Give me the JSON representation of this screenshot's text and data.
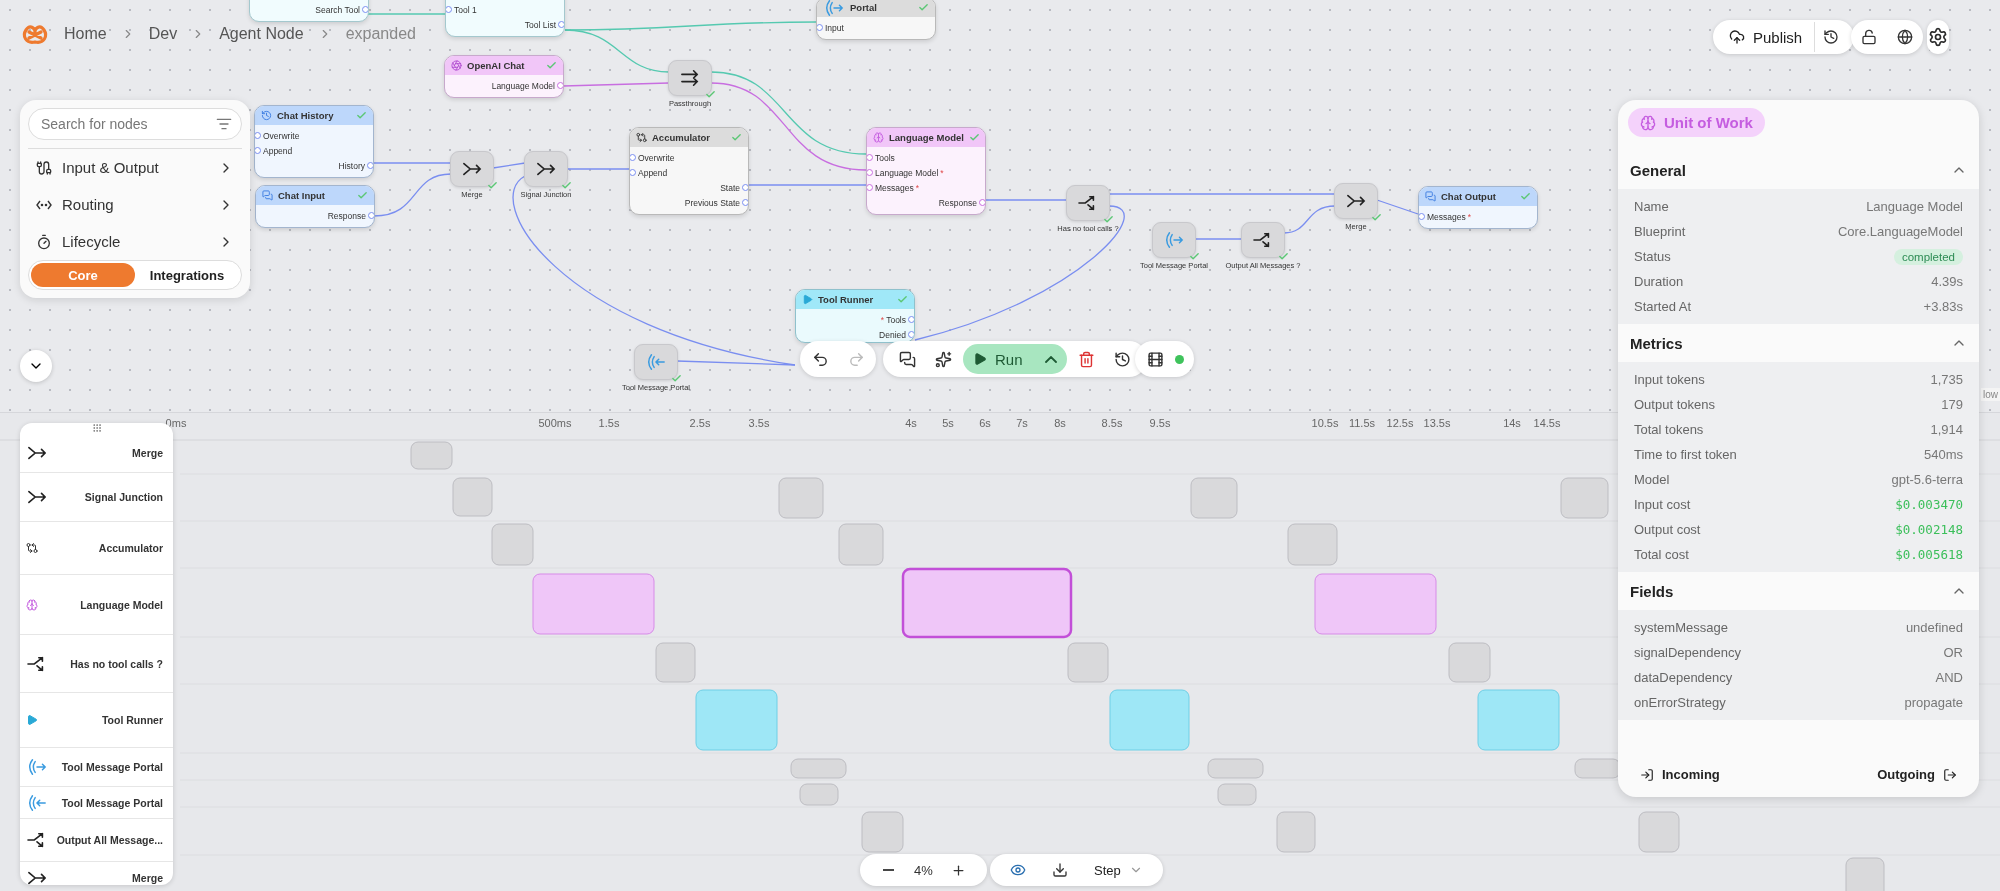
{
  "breadcrumbs": [
    "Home",
    "Dev",
    "Agent Node",
    "expanded"
  ],
  "top_actions": {
    "publish": "Publish"
  },
  "node_search": {
    "placeholder": "Search for nodes",
    "categories": [
      {
        "label": "Input & Output",
        "kind": "io"
      },
      {
        "label": "Routing",
        "kind": "routing"
      },
      {
        "label": "Lifecycle",
        "kind": "lifecycle"
      }
    ],
    "tabs": [
      {
        "label": "Core",
        "selected": true
      },
      {
        "label": "Integrations",
        "selected": false
      }
    ]
  },
  "nodes": [
    {
      "kind": "tool",
      "ports": [
        {
          "label": "Search Tool",
          "output": true
        }
      ]
    },
    {
      "kind": "tool",
      "ports": [
        {
          "label": "Tool 1",
          "output": false
        },
        {
          "label": "Tool List",
          "output": true
        }
      ]
    },
    {
      "kind": "portal",
      "title": "Portal",
      "color": "#dcdcdc",
      "completed": true,
      "ports": [
        {
          "label": "Input",
          "output": false
        }
      ]
    },
    {
      "kind": "llm-provider",
      "title": "OpenAI Chat",
      "color": "#f1c6f8",
      "completed": true,
      "ports": [
        {
          "label": "Language Model",
          "output": true
        }
      ]
    },
    {
      "kind": "passthrough",
      "title": "Passthrough",
      "completed": true
    },
    {
      "kind": "history",
      "title": "Chat History",
      "color": "#bdd7fb",
      "completed": true,
      "ports": [
        {
          "label": "Overwrite",
          "output": false
        },
        {
          "label": "Append",
          "output": false
        },
        {
          "label": "History",
          "output": true
        }
      ]
    },
    {
      "kind": "chat",
      "title": "Chat Input",
      "color": "#bdd7fb",
      "completed": true,
      "ports": [
        {
          "label": "Response",
          "output": true
        }
      ]
    },
    {
      "kind": "merge",
      "title": "Merge",
      "completed": true
    },
    {
      "kind": "merge",
      "title": "Signal Junction",
      "completed": true
    },
    {
      "kind": "accumulator",
      "title": "Accumulator",
      "color": "#dcdcdc",
      "completed": true,
      "ports": [
        {
          "label": "Overwrite",
          "output": false
        },
        {
          "label": "Append",
          "output": false
        },
        {
          "label": "State",
          "output": true
        },
        {
          "label": "Previous State",
          "output": true
        }
      ]
    },
    {
      "kind": "language-model",
      "title": "Language Model",
      "color": "#f1c6f8",
      "completed": true,
      "ports": [
        {
          "label": "Tools",
          "output": false
        },
        {
          "label": "Language Model",
          "output": false,
          "required_mark": "*"
        },
        {
          "label": "Messages",
          "output": false,
          "required_mark": "*"
        },
        {
          "label": "Response",
          "output": true
        }
      ]
    },
    {
      "kind": "condition",
      "title": "Has no tool calls ?",
      "completed": true
    },
    {
      "kind": "portal-out",
      "title": "Tool Message Portal",
      "completed": true
    },
    {
      "kind": "condition",
      "title": "Output All Messages ?",
      "completed": true
    },
    {
      "kind": "merge",
      "title": "Merge",
      "completed": true
    },
    {
      "kind": "chat",
      "title": "Chat Output",
      "color": "#bdd7fb",
      "completed": true,
      "ports": [
        {
          "label": "Messages",
          "output": false,
          "required_mark": "*"
        }
      ]
    },
    {
      "kind": "tool-runner",
      "title": "Tool Runner",
      "color": "#a0e8f8",
      "completed": true,
      "ports": [
        {
          "label": "Tools",
          "output": true,
          "required_mark": "*"
        },
        {
          "label": "Denied",
          "output": true
        }
      ]
    },
    {
      "kind": "portal-in",
      "title": "Tool Message Portal",
      "completed": true
    }
  ],
  "canvas_edge_text": "low",
  "toolbar": {
    "run": "Run",
    "live": true
  },
  "unit_panel": {
    "badge": "Unit of Work",
    "sections": [
      {
        "title": "General",
        "expanded": true,
        "rows": [
          {
            "label": "Name",
            "value": "Language Model",
            "kind": "text"
          },
          {
            "label": "Blueprint",
            "value": "Core.LanguageModel",
            "kind": "text"
          },
          {
            "label": "Status",
            "value": "completed",
            "kind": "status"
          },
          {
            "label": "Duration",
            "value": "4.39s",
            "kind": "text"
          },
          {
            "label": "Started At",
            "value": "+3.83s",
            "kind": "text"
          }
        ]
      },
      {
        "title": "Metrics",
        "expanded": true,
        "rows": [
          {
            "label": "Input tokens",
            "value": "1,735",
            "kind": "text"
          },
          {
            "label": "Output tokens",
            "value": "179",
            "kind": "text"
          },
          {
            "label": "Total tokens",
            "value": "1,914",
            "kind": "text"
          },
          {
            "label": "Time to first token",
            "value": "540ms",
            "kind": "text"
          },
          {
            "label": "Model",
            "value": "gpt-5.6-terra",
            "kind": "text"
          },
          {
            "label": "Input cost",
            "value": "$0.003470",
            "kind": "cost"
          },
          {
            "label": "Output cost",
            "value": "$0.002148",
            "kind": "cost"
          },
          {
            "label": "Total cost",
            "value": "$0.005618",
            "kind": "cost"
          }
        ]
      },
      {
        "title": "Fields",
        "expanded": true,
        "rows": [
          {
            "label": "systemMessage",
            "value": "undefined",
            "kind": "text"
          },
          {
            "label": "signalDependency",
            "value": "OR",
            "kind": "text"
          },
          {
            "label": "dataDependency",
            "value": "AND",
            "kind": "text"
          },
          {
            "label": "onErrorStrategy",
            "value": "propagate",
            "kind": "text"
          }
        ]
      }
    ],
    "incoming": "Incoming",
    "outgoing": "Outgoing"
  },
  "timeline": {
    "ticks": [
      "0ms",
      "500ms",
      "1.5s",
      "2.5s",
      "3.5s",
      "4s",
      "5s",
      "6s",
      "7s",
      "8s",
      "8.5s",
      "9.5s",
      "10.5s",
      "11.5s",
      "12.5s",
      "13.5s",
      "14s",
      "14.5s"
    ],
    "lanes": [
      {
        "label": "Merge",
        "kind": "merge"
      },
      {
        "label": "Signal Junction",
        "kind": "merge"
      },
      {
        "label": "Accumulator",
        "kind": "accumulator"
      },
      {
        "label": "Language Model",
        "kind": "language-model"
      },
      {
        "label": "Has no tool calls ?",
        "kind": "condition"
      },
      {
        "label": "Tool Runner",
        "kind": "tool-runner"
      },
      {
        "label": "Tool Message Portal",
        "kind": "portal-out"
      },
      {
        "label": "Tool Message Portal",
        "kind": "portal-in"
      },
      {
        "label": "Output All Message...",
        "kind": "condition"
      },
      {
        "label": "Merge",
        "kind": "merge"
      }
    ],
    "zoom": "4%",
    "mode": "Step"
  }
}
